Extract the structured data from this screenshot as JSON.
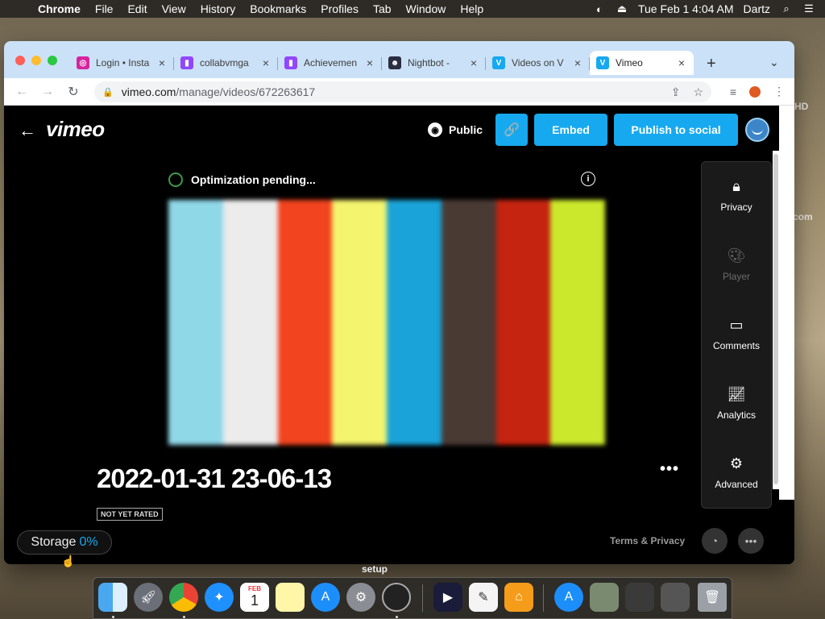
{
  "menubar": {
    "app": "Chrome",
    "items": [
      "File",
      "Edit",
      "View",
      "History",
      "Bookmarks",
      "Profiles",
      "Tab",
      "Window",
      "Help"
    ],
    "datetime": "Tue Feb 1  4:04 AM",
    "user": "Dartz"
  },
  "desktop": {
    "text_hd": "HD",
    "text_com": "com"
  },
  "browser": {
    "tabs": [
      {
        "title": "Login • Insta",
        "icon": "instagram-icon",
        "color": "#d6249f"
      },
      {
        "title": "collabvmga",
        "icon": "twitch-icon",
        "color": "#9146ff"
      },
      {
        "title": "Achievemen",
        "icon": "twitch-icon",
        "color": "#9146ff"
      },
      {
        "title": "Nightbot - ",
        "icon": "nightbot-icon",
        "color": "#2b2d42"
      },
      {
        "title": "Videos on V",
        "icon": "vimeo-icon",
        "color": "#17a9ef"
      },
      {
        "title": "Vimeo",
        "icon": "vimeo-icon",
        "color": "#17a9ef"
      }
    ],
    "url_host": "vimeo.com",
    "url_path": "/manage/videos/672263617"
  },
  "vimeo": {
    "logo": "vimeo",
    "privacy_status": "Public",
    "embed_label": "Embed",
    "publish_label": "Publish to social",
    "optimization_status": "Optimization pending...",
    "video_title": "2022-01-31 23-06-13",
    "rating_badge": "NOT YET RATED",
    "color_bars": [
      "#8fd8e8",
      "#ececec",
      "#f1441f",
      "#f4f46e",
      "#1aa3d8",
      "#4a3a34",
      "#c42410",
      "#cbe82c"
    ],
    "side_panel": [
      {
        "label": "Privacy",
        "icon": "lock-icon",
        "enabled": true
      },
      {
        "label": "Player",
        "icon": "palette-icon",
        "enabled": false
      },
      {
        "label": "Comments",
        "icon": "comment-icon",
        "enabled": true
      },
      {
        "label": "Analytics",
        "icon": "analytics-icon",
        "enabled": true
      },
      {
        "label": "Advanced",
        "icon": "gear-icon",
        "enabled": true
      }
    ],
    "storage_label": "Storage",
    "storage_pct": "0%",
    "terms_label": "Terms & Privacy"
  },
  "dock": {
    "hover_label": "setup",
    "apps": [
      "Finder",
      "Launchpad",
      "Chrome",
      "Safari",
      "Calendar",
      "Notes",
      "App Store",
      "System Preferences",
      "OBS",
      "Premiere",
      "TextEdit",
      "Home",
      "App Store Installer",
      "Preview",
      "Downloads",
      "Folder",
      "Trash"
    ],
    "calendar_month": "FEB",
    "calendar_day": "1"
  }
}
